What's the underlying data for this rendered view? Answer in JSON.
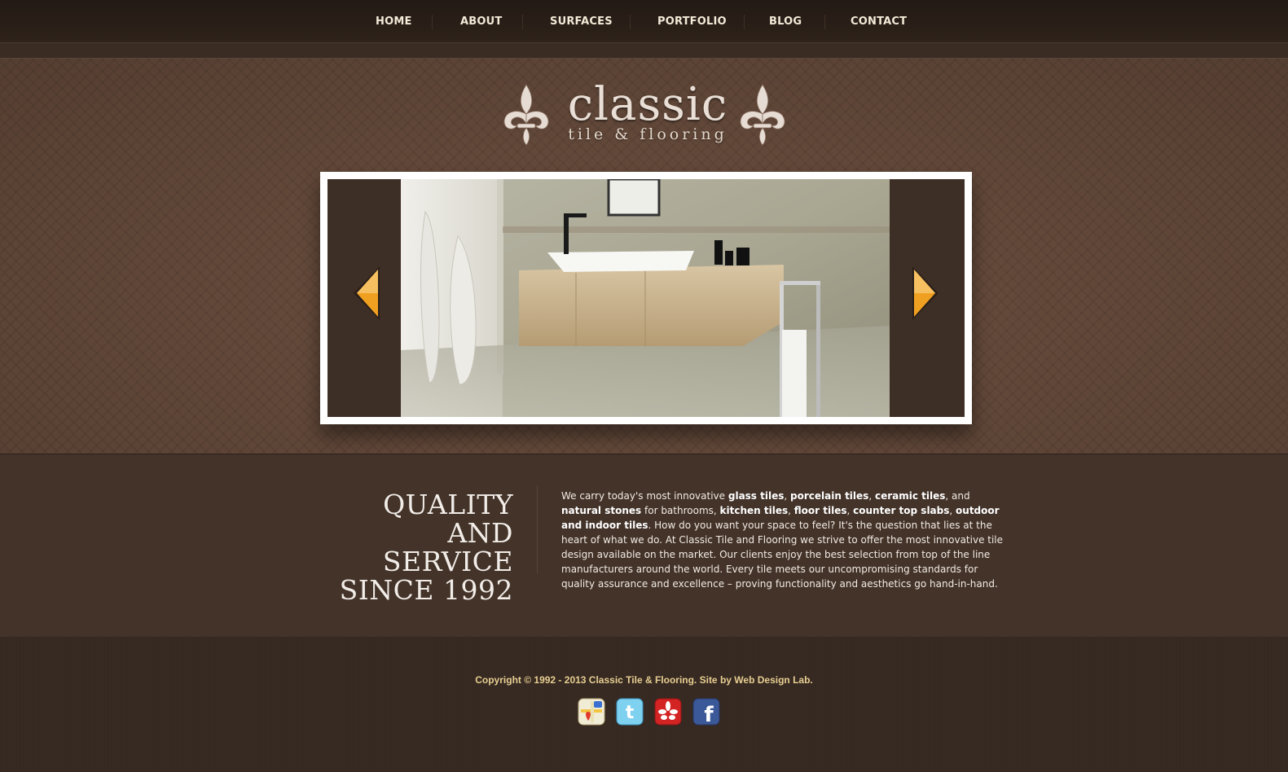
{
  "nav": {
    "items": [
      {
        "label": "HOME"
      },
      {
        "label": "ABOUT"
      },
      {
        "label": "SURFACES"
      },
      {
        "label": "PORTFOLIO"
      },
      {
        "label": "BLOG"
      },
      {
        "label": "CONTACT"
      }
    ]
  },
  "logo": {
    "word": "classic",
    "sub": "tile & flooring"
  },
  "quality": {
    "title_lines": [
      "QUALITY",
      "AND SERVICE",
      "SINCE 1992"
    ],
    "p1": "We carry today's most innovative ",
    "b1": "glass tiles",
    "p2": ", ",
    "b2": "porcelain tiles",
    "p3": ", ",
    "b3": "ceramic tiles",
    "p4": ", and ",
    "b4": "natural stones",
    "p5": " for bathrooms, ",
    "b5": "kitchen tiles",
    "p6": ", ",
    "b6": "floor tiles",
    "p7": ", ",
    "b7": "counter top slabs",
    "p8": ", ",
    "b8": "outdoor and indoor tiles",
    "p9": ". How do you want your space to feel? It's the question that lies at the heart of what we do. At Classic Tile and Flooring we strive to offer the most innovative tile design available on the market. Our clients enjoy the best selection from top of the line manufacturers around the world. Every tile meets our uncompromising standards for quality assurance and excellence – proving functionality and aesthetics go hand-in-hand."
  },
  "footer": {
    "copyright": "Copyright © 1992 - 2013 Classic Tile & Flooring. Site by ",
    "credit_link": "Web Design Lab",
    "copyright_end": "."
  },
  "social_icons": [
    "maps-icon",
    "twitter-icon",
    "yelp-icon",
    "facebook-icon"
  ],
  "colors": {
    "nav_text": "#f4ead8",
    "accent_arrow": "#f0a020",
    "footer_text": "#e8cf93"
  }
}
